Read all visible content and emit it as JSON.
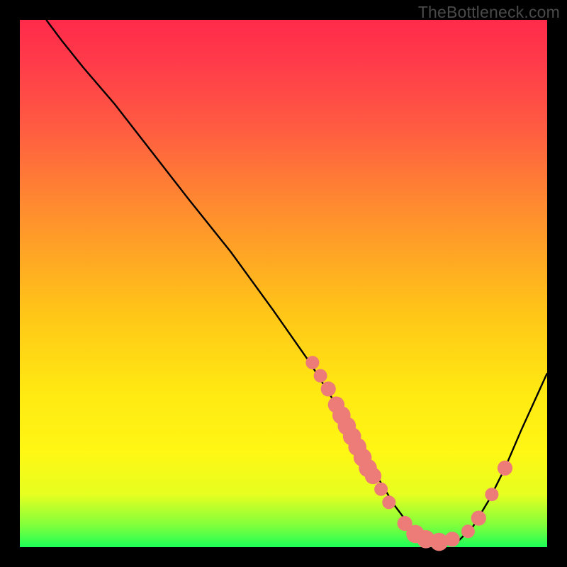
{
  "watermark": "TheBottleneck.com",
  "chart_data": {
    "type": "line",
    "title": "",
    "xlabel": "",
    "ylabel": "",
    "xlim": [
      0,
      100
    ],
    "ylim": [
      0,
      100
    ],
    "grid": false,
    "series": [
      {
        "name": "curve",
        "x": [
          5,
          8,
          12,
          18,
          25,
          32,
          40,
          48,
          55,
          60,
          64,
          68,
          71,
          74,
          77,
          80,
          83,
          86,
          89,
          92,
          95,
          100
        ],
        "y": [
          100,
          96,
          91,
          84,
          75,
          66,
          56,
          45,
          35,
          27,
          20,
          13,
          8,
          4,
          2,
          1,
          1,
          4,
          9,
          15,
          22,
          33
        ]
      }
    ],
    "markers": [
      {
        "x": 55.5,
        "y": 35.0,
        "r": 1.0
      },
      {
        "x": 57.0,
        "y": 32.5,
        "r": 1.0
      },
      {
        "x": 58.5,
        "y": 30.0,
        "r": 1.2
      },
      {
        "x": 60.0,
        "y": 27.0,
        "r": 1.4
      },
      {
        "x": 61.0,
        "y": 25.0,
        "r": 1.6
      },
      {
        "x": 62.0,
        "y": 23.0,
        "r": 1.6
      },
      {
        "x": 63.0,
        "y": 21.0,
        "r": 1.6
      },
      {
        "x": 64.0,
        "y": 19.0,
        "r": 1.6
      },
      {
        "x": 65.0,
        "y": 17.0,
        "r": 1.6
      },
      {
        "x": 66.0,
        "y": 15.0,
        "r": 1.6
      },
      {
        "x": 67.0,
        "y": 13.5,
        "r": 1.4
      },
      {
        "x": 68.5,
        "y": 11.0,
        "r": 1.0
      },
      {
        "x": 70.0,
        "y": 8.5,
        "r": 1.0
      },
      {
        "x": 73.0,
        "y": 4.5,
        "r": 1.2
      },
      {
        "x": 75.0,
        "y": 2.5,
        "r": 1.6
      },
      {
        "x": 77.0,
        "y": 1.5,
        "r": 1.6
      },
      {
        "x": 79.5,
        "y": 1.0,
        "r": 1.6
      },
      {
        "x": 82.0,
        "y": 1.5,
        "r": 1.2
      },
      {
        "x": 85.0,
        "y": 3.0,
        "r": 1.0
      },
      {
        "x": 87.0,
        "y": 5.5,
        "r": 1.2
      },
      {
        "x": 89.5,
        "y": 10.0,
        "r": 1.0
      },
      {
        "x": 92.0,
        "y": 15.0,
        "r": 1.2
      }
    ],
    "marker_color": "#ed7c79",
    "line_color": "#000000"
  }
}
